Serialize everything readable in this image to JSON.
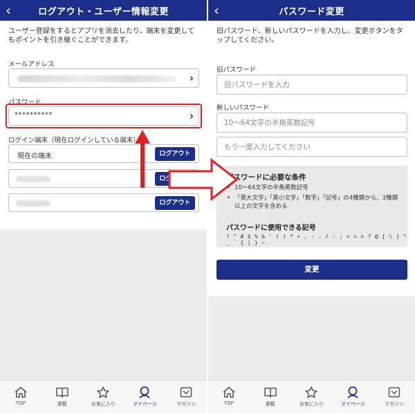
{
  "colors": {
    "header": "#1b2f8a",
    "highlight": "#e31e24",
    "button": "#1b2f8a"
  },
  "left": {
    "header": {
      "back": "‹",
      "title": "ログアウト・ユーザー情報変更"
    },
    "intro": "ユーザー登録をするとアプリを消去したり、端末を変更してもポイントを引き継ぐことができます。",
    "email_label": "メールアドレス",
    "password_label": "パスワード",
    "password_masked": "**********",
    "devices_label": "ログイン端末（現在ログインしている端末）",
    "devices": [
      {
        "name": "現在の端末",
        "button": "ログアウト"
      },
      {
        "name": "",
        "button": "ログアウト"
      },
      {
        "name": "",
        "button": "ログアウト"
      }
    ]
  },
  "right": {
    "header": {
      "back": "‹",
      "title": "パスワード変更"
    },
    "intro": "旧パスワード、新しいパスワードを入力し、変更ボタンをタップしてください。",
    "old_label": "旧パスワード",
    "old_placeholder": "旧パスワードを入力",
    "new_label": "新しいパスワード",
    "new_placeholder": "10～64文字の半角英数記号",
    "confirm_placeholder": "もう一度入力してください",
    "conditions_title": "パスワードに必要な条件",
    "conditions": [
      "10～64文字の半角英数記号",
      "「英大文字」「英小文字」「数字」「記号」の4種類から、3種類以上の文字を含める"
    ],
    "symbols_title": "パスワードに使用できる記号",
    "symbols": "! \" # $ % & ' ( ) * + , - . / : ; < = > ? @ [ \\ ] ^ _ ` { | } ~",
    "submit": "変更"
  },
  "tabs": [
    {
      "label": "TOP",
      "icon": "home-icon"
    },
    {
      "label": "連載",
      "icon": "book-icon"
    },
    {
      "label": "お気に入り",
      "icon": "star-icon"
    },
    {
      "label": "マイページ",
      "icon": "person-icon",
      "active": true
    },
    {
      "label": "マガジン",
      "icon": "magazine-icon"
    }
  ]
}
